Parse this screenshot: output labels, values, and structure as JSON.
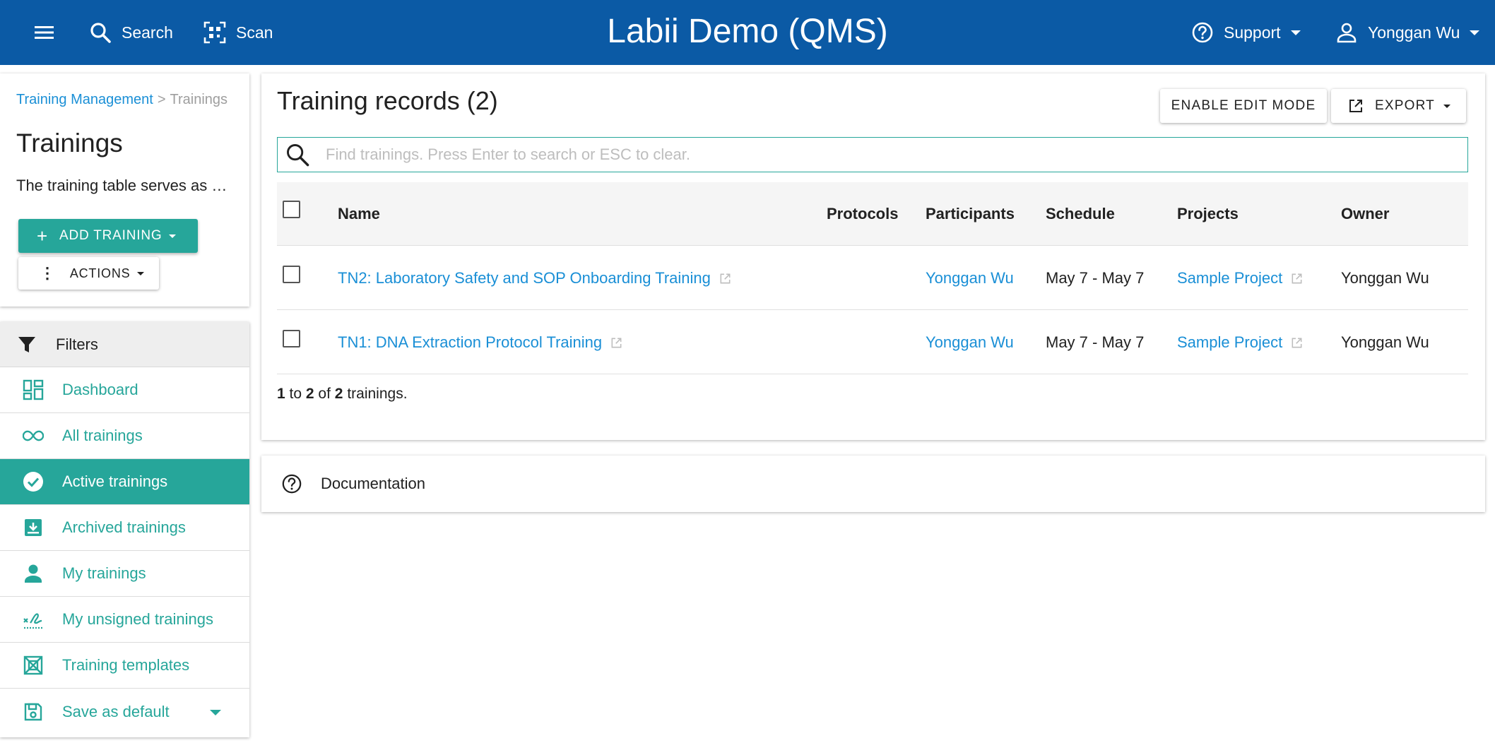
{
  "topbar": {
    "menu_icon": "hamburger-menu-icon",
    "search_label": "Search",
    "scan_label": "Scan",
    "app_title": "Labii Demo (QMS)",
    "support_label": "Support",
    "user_label": "Yonggan Wu",
    "brand_color": "#0b5aa5"
  },
  "sidebar": {
    "breadcrumb": {
      "parent": "Training Management",
      "separator": ">",
      "current": "Trainings"
    },
    "title": "Trainings",
    "description": "The training table serves as a…",
    "add_button": "ADD TRAINING",
    "actions_button": "ACTIONS",
    "filters_heading": "Filters",
    "items": [
      {
        "label": "Dashboard",
        "icon": "dashboard-icon"
      },
      {
        "label": "All trainings",
        "icon": "infinity-icon"
      },
      {
        "label": "Active trainings",
        "icon": "check-circle-icon",
        "active": true
      },
      {
        "label": "Archived trainings",
        "icon": "archive-icon"
      },
      {
        "label": "My trainings",
        "icon": "person-icon"
      },
      {
        "label": "My unsigned trainings",
        "icon": "signature-icon"
      },
      {
        "label": "Training templates",
        "icon": "template-icon"
      },
      {
        "label": "Save as default",
        "icon": "save-icon"
      }
    ],
    "accent_color": "#26a69a"
  },
  "main": {
    "title": "Training records (2)",
    "edit_mode_button": "ENABLE EDIT MODE",
    "export_button": "EXPORT",
    "search_placeholder": "Find trainings. Press Enter to search or ESC to clear.",
    "columns": [
      "Name",
      "Protocols",
      "Participants",
      "Schedule",
      "Projects",
      "Owner"
    ],
    "rows": [
      {
        "name": "TN2: Laboratory Safety and SOP Onboarding Training",
        "protocols": "",
        "participants": "Yonggan Wu",
        "schedule": "May 7 - May 7",
        "projects": "Sample Project",
        "owner": "Yonggan Wu"
      },
      {
        "name": "TN1: DNA Extraction Protocol Training",
        "protocols": "",
        "participants": "Yonggan Wu",
        "schedule": "May 7 - May 7",
        "projects": "Sample Project",
        "owner": "Yonggan Wu"
      }
    ],
    "count": {
      "from": "1",
      "to_word": "to",
      "to": "2",
      "of_word": "of",
      "total": "2",
      "suffix": "trainings."
    }
  },
  "documentation": {
    "label": "Documentation"
  }
}
